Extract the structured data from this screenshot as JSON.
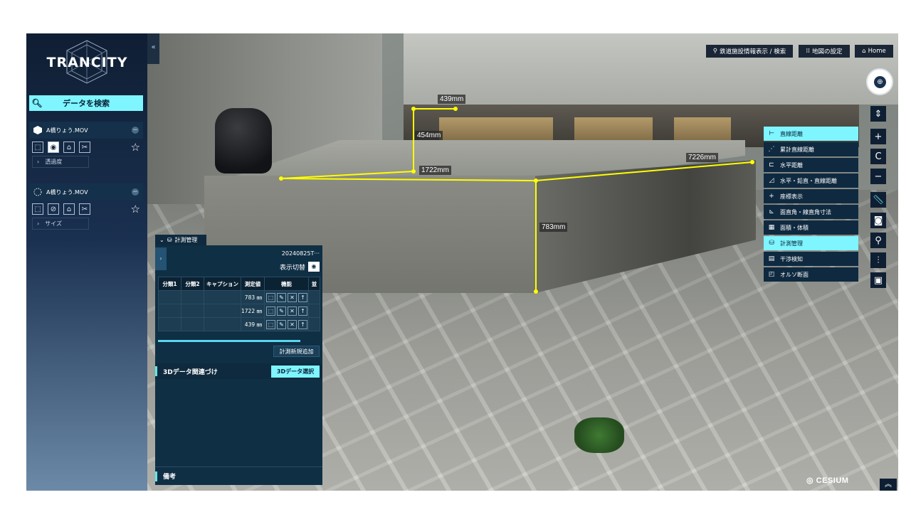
{
  "sidebar": {
    "logo_text": "TRANCITY",
    "search_label": "データを検索",
    "layers": [
      {
        "title": "A橋りょう.MOV",
        "sub_label": "透過度"
      },
      {
        "title": "A橋りょう.MOV",
        "sub_label": "サイズ"
      }
    ]
  },
  "topbar": {
    "facility_search": "鉄道施設情報表示 / 検索",
    "map_settings": "地図の設定",
    "home": "Home"
  },
  "measurements": {
    "labels": [
      "439mm",
      "454mm",
      "1722mm",
      "7226mm",
      "783mm"
    ]
  },
  "measure_menu": [
    {
      "label": "直線距離",
      "icon": "straight-distance-icon"
    },
    {
      "label": "累計直線距離",
      "icon": "cumulative-distance-icon"
    },
    {
      "label": "水平距離",
      "icon": "horizontal-distance-icon"
    },
    {
      "label": "水平・鉛直・直線距離",
      "icon": "triangle-distance-icon"
    },
    {
      "label": "座標表示",
      "icon": "crosshair-icon"
    },
    {
      "label": "面直角・線直角寸法",
      "icon": "perpendicular-icon"
    },
    {
      "label": "面積・体積",
      "icon": "area-volume-icon"
    },
    {
      "label": "計測管理",
      "icon": "database-icon"
    },
    {
      "label": "干渉検知",
      "icon": "interference-icon"
    },
    {
      "label": "オルソ断面",
      "icon": "ortho-section-icon"
    }
  ],
  "panel": {
    "tab_label": "計測管理",
    "date": "20240825T···",
    "toggle_label": "表示切替",
    "columns": [
      "分類1",
      "分類2",
      "キャプション",
      "測定値",
      "機能",
      "並"
    ],
    "rows": [
      {
        "value": "783 ㎜"
      },
      {
        "value": "1722 ㎜"
      },
      {
        "value": "439 ㎜"
      }
    ],
    "add_button": "計測新規追加",
    "section_3d": "3Dデータ関連づけ",
    "select_3d": "3Dデータ選択",
    "section_note": "備考"
  },
  "footer": {
    "cesium_text": "CESIUM"
  },
  "colors": {
    "accent": "#7ef5ff",
    "panel_bg": "#0f2f44",
    "measure_line": "#ffff00"
  }
}
